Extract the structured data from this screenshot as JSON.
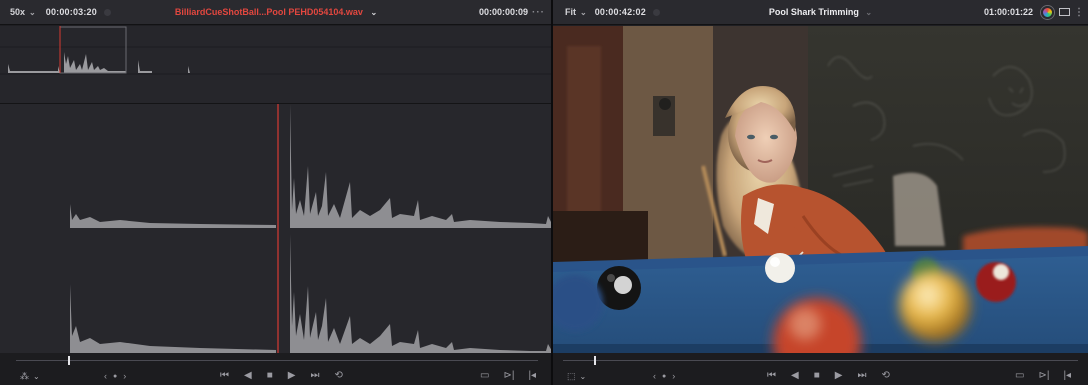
{
  "source_viewer": {
    "zoom": "50x",
    "timecode": "00:00:03:20",
    "clip_name": "BilliardCueShotBall...Pool PEHD054104.wav",
    "duration": "00:00:00:09",
    "more": "···",
    "playhead_fraction": 0.1
  },
  "timeline_viewer": {
    "fit": "Fit",
    "timecode": "00:00:42:02",
    "timeline_name": "Pool Shark Trimming",
    "record_timecode": "01:00:01:22",
    "more": "···",
    "playhead_fraction": 0.06
  },
  "transport_icons": [
    "jump-to-start",
    "step-back",
    "stop",
    "play",
    "jump-to-end",
    "loop"
  ],
  "colors": {
    "clip_name": "#e2473f",
    "playhead": "#d63a32",
    "waveform": "#8e8e92",
    "table_felt": "#2f5f93"
  }
}
